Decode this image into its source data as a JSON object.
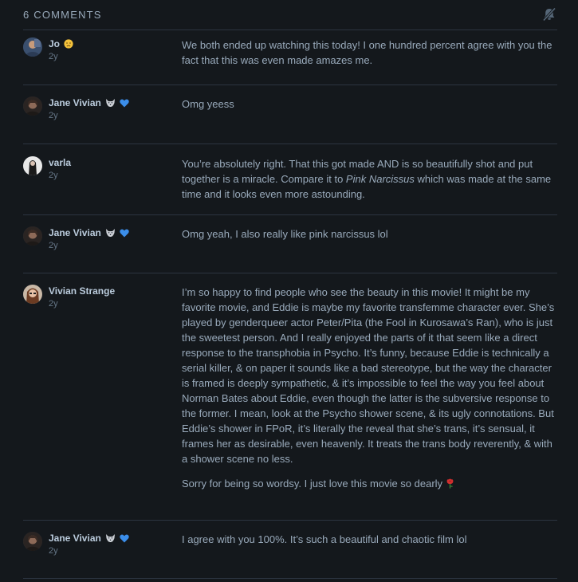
{
  "header": {
    "title": "6 COMMENTS",
    "mute_icon": "bell-slash-icon"
  },
  "comments": [
    {
      "author": "Jo",
      "badge_icon": "sad-face-emoji-icon",
      "time": "2y",
      "paragraphs": [
        "We both ended up watching this today! I one hundred percent agree with you the fact that this was even made amazes me."
      ]
    },
    {
      "author": "Jane Vivian",
      "badge_icon": "wolf-emoji-icon",
      "badge2_icon": "blue-heart-emoji-icon",
      "time": "2y",
      "paragraphs": [
        "Omg yeess"
      ]
    },
    {
      "author": "varla",
      "time": "2y",
      "p1_before": "You’re absolutely right. That this got made AND is so beautifully shot and put together is a miracle. Compare it to ",
      "p1_italic": "Pink Narcissus",
      "p1_after": " which was made at the same time and it looks even more astounding."
    },
    {
      "author": "Jane Vivian",
      "badge_icon": "wolf-emoji-icon",
      "badge2_icon": "blue-heart-emoji-icon",
      "time": "2y",
      "paragraphs": [
        "Omg yeah, I also really like pink narcissus lol"
      ]
    },
    {
      "author": "Vivian Strange",
      "time": "2y",
      "paragraphs": [
        "I’m so happy to find people who see the beauty in this movie! It might be my favorite movie, and Eddie is maybe my favorite transfemme character ever. She’s played by genderqueer actor Peter/Pita (the Fool in Kurosawa’s Ran), who is just the sweetest person. And I really enjoyed the parts of it that seem like a direct response to the transphobia in Psycho. It’s funny, because Eddie is technically a serial killer, & on paper it sounds like a bad stereotype, but the way the character is framed is deeply sympathetic, & it’s impossible to feel the way you feel about Norman Bates about Eddie, even though the latter is the subversive response to the former. I mean, look at the Psycho shower scene, & its ugly connotations. But Eddie’s shower in FPoR, it’s literally the reveal that she’s trans, it’s sensual, it frames her as desirable, even heavenly. It treats the trans body reverently, & with a shower scene no less.",
        "Sorry for being so wordsy. I just love this movie so dearly"
      ],
      "end_icon": "rose-emoji-icon"
    },
    {
      "author": "Jane Vivian",
      "badge_icon": "wolf-emoji-icon",
      "badge2_icon": "blue-heart-emoji-icon",
      "time": "2y",
      "paragraphs": [
        "I agree with you 100%. It’s such a beautiful and chaotic film lol"
      ]
    }
  ],
  "colors": {
    "background": "#14181c",
    "text": "#99aabb",
    "author": "#bbccdd",
    "divider": "#2c3440",
    "heart": "#3b8eea"
  }
}
